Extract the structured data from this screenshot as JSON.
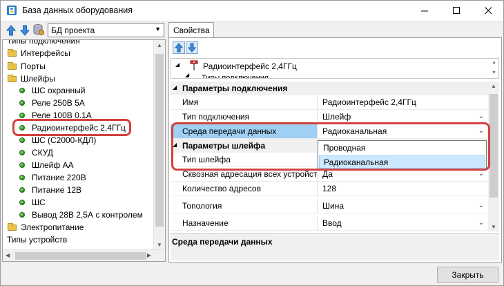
{
  "window": {
    "title": "База данных оборудования",
    "close_label": "Закрыть"
  },
  "left_toolbar": {
    "source_value": "БД проекта"
  },
  "tree": {
    "items": [
      {
        "label": "Типы подключения",
        "type": "text",
        "level": 0
      },
      {
        "label": "Интерфейсы",
        "type": "folder",
        "level": 0
      },
      {
        "label": "Порты",
        "type": "folder",
        "level": 0
      },
      {
        "label": "Шлейфы",
        "type": "folder",
        "level": 0
      },
      {
        "label": "ШС охранный",
        "type": "dot",
        "level": 1
      },
      {
        "label": "Реле 250В 5А",
        "type": "dot",
        "level": 1
      },
      {
        "label": "Реле 100В 0.1А",
        "type": "dot",
        "level": 1
      },
      {
        "label": "Радиоинтерфейс 2,4ГГц",
        "type": "dot",
        "level": 1
      },
      {
        "label": "ШС  (С2000-КДЛ)",
        "type": "dot",
        "level": 1
      },
      {
        "label": "СКУД",
        "type": "dot",
        "level": 1
      },
      {
        "label": "Шлейф АА",
        "type": "dot",
        "level": 1
      },
      {
        "label": "Питание 220В",
        "type": "dot",
        "level": 1
      },
      {
        "label": "Питание 12В",
        "type": "dot",
        "level": 1
      },
      {
        "label": "ШС",
        "type": "dot",
        "level": 1
      },
      {
        "label": "Вывод 28В 2,5А с контролем",
        "type": "dot",
        "level": 1
      },
      {
        "label": "Электропитание",
        "type": "folder",
        "level": 0
      },
      {
        "label": "Типы устройств",
        "type": "text",
        "level": 0
      }
    ]
  },
  "properties": {
    "tab_label": "Свойства",
    "header_item": "Радиоинтерфейс 2,4ГГц",
    "header_sub": "Типы подключения",
    "category_connection": "Параметры подключения",
    "row_name": {
      "name": "Имя",
      "value": "Радиоинтерфейс 2,4ГГц"
    },
    "row_conn_type": {
      "name": "Тип подключения",
      "value": "Шлейф"
    },
    "row_medium": {
      "name": "Среда передачи данных",
      "value": "Радиоканальная"
    },
    "category_loop": "Параметры шлейфа",
    "row_loop_type": {
      "name": "Тип шлейфа",
      "value": ""
    },
    "row_through": {
      "name": "Сквозная адресация всех устройств",
      "value": "Да"
    },
    "row_addr_count": {
      "name": "Количество адресов",
      "value": "128"
    },
    "row_topology": {
      "name": "Топология",
      "value": "Шина"
    },
    "row_purpose": {
      "name": "Назначение",
      "value": "Ввод"
    },
    "description_title": "Среда передачи данных"
  },
  "dropdown": {
    "options": [
      "Проводная",
      "Радиоканальная"
    ],
    "selected": "Радиоканальная"
  },
  "colors": {
    "highlight": "#d3413d",
    "selection": "#9fcff3",
    "dropdown_active": "#cce8ff"
  }
}
